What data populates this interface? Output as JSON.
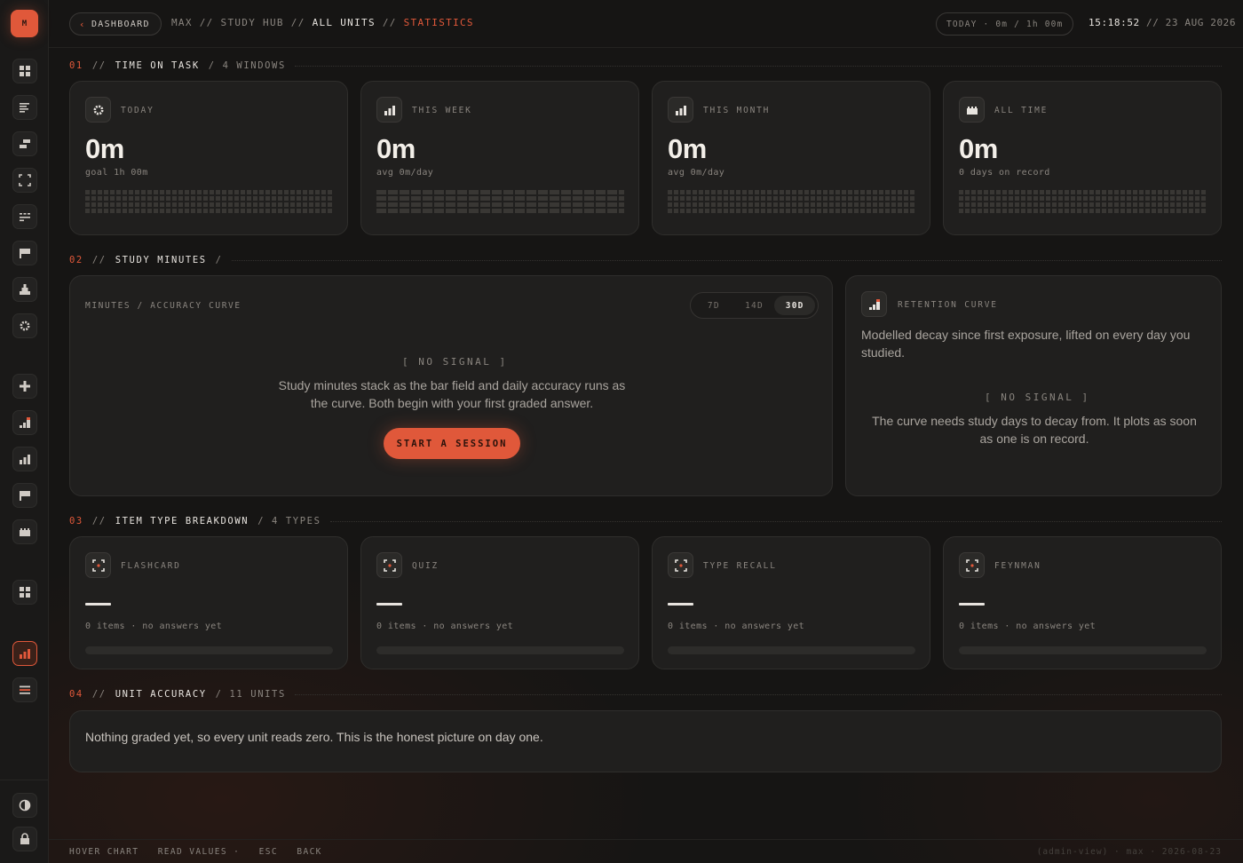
{
  "app": {
    "logo_letter": "M",
    "accent_color": "#e0583a"
  },
  "sidebar": {
    "top_items": [
      {
        "name": "grid-icon"
      },
      {
        "name": "list-icon"
      },
      {
        "name": "stack-icon"
      },
      {
        "name": "focus-icon"
      },
      {
        "name": "table-icon"
      },
      {
        "name": "flag-icon"
      },
      {
        "name": "pyramid-icon"
      },
      {
        "name": "gear-icon"
      }
    ],
    "mid_items": [
      {
        "name": "plus-icon"
      },
      {
        "name": "chart-rising-icon"
      },
      {
        "name": "bar-chart-icon"
      },
      {
        "name": "flag-icon"
      },
      {
        "name": "calendar-icon"
      }
    ],
    "lower_items": [
      {
        "name": "grid-icon"
      },
      {
        "name": "stats-icon"
      },
      {
        "name": "menu-icon"
      }
    ],
    "bottom_items": [
      {
        "name": "theme-toggle-icon"
      },
      {
        "name": "lock-icon"
      }
    ]
  },
  "topbar": {
    "back_label": "DASHBOARD",
    "crumb_1": "MAX",
    "sep": "//",
    "crumb_2": "STUDY HUB",
    "crumb_3": "ALL UNITS",
    "crumb_4": "STATISTICS",
    "today_pill": "TODAY · 0m / 1h 00m",
    "clock_time": "15:18:52",
    "clock_date": "// 23 AUG 2026"
  },
  "sections": {
    "s1": {
      "num": "01",
      "sep": "//",
      "title": "TIME ON TASK",
      "tail": "/ 4 WINDOWS"
    },
    "s2": {
      "num": "02",
      "sep": "//",
      "title": "STUDY MINUTES",
      "tail": "/"
    },
    "s3": {
      "num": "03",
      "sep": "//",
      "title": "ITEM TYPE BREAKDOWN",
      "tail": "/ 4 TYPES"
    },
    "s4": {
      "num": "04",
      "sep": "//",
      "title": "UNIT ACCURACY",
      "tail": "/ 11 UNITS"
    }
  },
  "time_cards": [
    {
      "label": "TODAY",
      "value": "0m",
      "sub": "goal 1h 00m"
    },
    {
      "label": "THIS WEEK",
      "value": "0m",
      "sub": "avg 0m/day"
    },
    {
      "label": "THIS MONTH",
      "value": "0m",
      "sub": "avg 0m/day"
    },
    {
      "label": "ALL TIME",
      "value": "0m",
      "sub": "0 days on record"
    }
  ],
  "minutes_chart": {
    "label": "MINUTES / ACCURACY CURVE",
    "ranges": [
      "7D",
      "14D",
      "30D"
    ],
    "selected_range": "30D",
    "no_signal": "[ NO SIGNAL ]",
    "empty_text": "Study minutes stack as the bar field and daily accuracy runs as the curve. Both begin with your first graded answer.",
    "cta": "START A SESSION"
  },
  "retention": {
    "label": "RETENTION CURVE",
    "desc": "Modelled decay since first exposure, lifted on every day you studied.",
    "no_signal": "[ NO SIGNAL ]",
    "empty_text": "The curve needs study days to decay from. It plots as soon as one is on record."
  },
  "item_types": [
    {
      "label": "FLASHCARD",
      "sub": "0 items · no answers yet"
    },
    {
      "label": "QUIZ",
      "sub": "0 items · no answers yet"
    },
    {
      "label": "TYPE RECALL",
      "sub": "0 items · no answers yet"
    },
    {
      "label": "FEYNMAN",
      "sub": "0 items · no answers yet"
    }
  ],
  "unit_accuracy": {
    "text": "Nothing graded yet, so every unit reads zero. This is the honest picture on day one."
  },
  "footer": {
    "hint_1": "HOVER CHART",
    "hint_2": "READ VALUES ·",
    "hint_3": "ESC",
    "hint_4": "BACK",
    "right": "(admin-view) · max · 2026-08-23"
  }
}
